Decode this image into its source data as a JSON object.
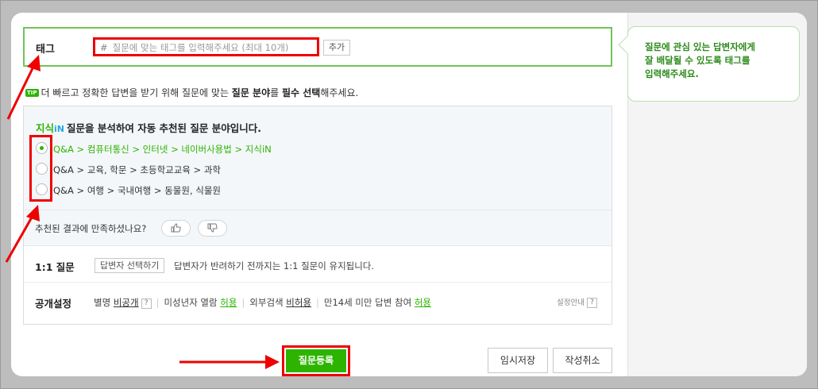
{
  "tip_bubble": "질문에 관심 있는 답변자에게\n잘 배달될 수 있도록 태그를\n입력해주세요.",
  "tag": {
    "label": "태그",
    "hash": "#",
    "placeholder": "질문에 맞는 태그를 입력해주세요 (최대 10개)",
    "add_button": "추가"
  },
  "notice": {
    "badge": "TIP",
    "text_before": "더 빠르고 정확한 답변을 받기 위해 질문에 맞는 ",
    "bold1": "질문 분야",
    "text_mid": "를 ",
    "bold2": "필수 선택",
    "text_after": "해주세요."
  },
  "recommend": {
    "brand": "지식",
    "brand_mark": "iN",
    "title": "질문을 분석하여 자동 추천된 질문 분야입니다.",
    "options": [
      {
        "label": "Q&A > 컴퓨터통신 > 인터넷 > 네이버사용법 > 지식iN",
        "selected": true
      },
      {
        "label": "Q&A > 교육, 학문 > 초등학교교육 > 과학",
        "selected": false
      },
      {
        "label": "Q&A > 여행 > 국내여행 > 동물원, 식물원",
        "selected": false
      }
    ],
    "feedback_question": "추천된 결과에 만족하셨나요?",
    "thumb_up_icon": "thumbs-up-icon",
    "thumb_down_icon": "thumbs-down-icon"
  },
  "one_to_one": {
    "label": "1:1 질문",
    "button": "답변자 선택하기",
    "desc": "답변자가 반려하기 전까지는 1:1 질문이 유지됩니다."
  },
  "public": {
    "label": "공개설정",
    "alias_label": "별명",
    "alias_value": "비공개",
    "minor_label": "미성년자 열람",
    "minor_value": "허용",
    "external_label": "외부검색",
    "external_value": "비허용",
    "under14_label": "만14세 미만 답변 참여",
    "under14_value": "허용",
    "help_label": "설정안내",
    "question_mark": "?"
  },
  "buttons": {
    "submit": "질문등록",
    "save_draft": "임시저장",
    "cancel": "작성취소"
  },
  "colors": {
    "accent_green": "#2db400",
    "highlight_red": "#e00000"
  }
}
